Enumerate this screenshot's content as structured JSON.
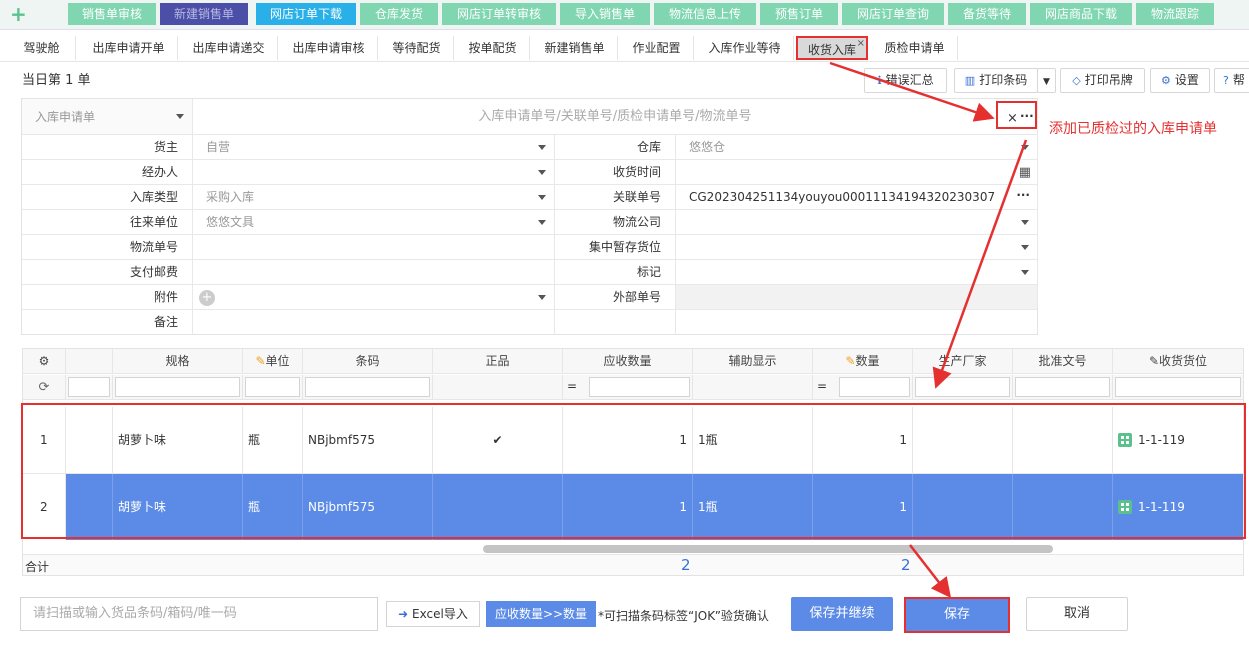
{
  "topnav": {
    "plus": "+",
    "tabs": [
      "销售单审核",
      "新建销售单",
      "网店订单下载",
      "仓库发货",
      "网店订单转审核",
      "导入销售单",
      "物流信息上传",
      "预售订单",
      "网店订单查询",
      "备货等待",
      "网店商品下载",
      "物流跟踪"
    ]
  },
  "subtabs": [
    "驾驶舱",
    "出库申请开单",
    "出库申请递交",
    "出库申请审核",
    "等待配货",
    "按单配货",
    "新建销售单",
    "作业配置",
    "入库作业等待",
    "收货入库",
    "质检申请单"
  ],
  "subtab_close": "×",
  "count_label": "当日第 1 单",
  "toolbar": {
    "errors": "错误汇总",
    "print_barcode": "打印条码",
    "print_tag": "打印吊牌",
    "settings": "设置",
    "help": "帮"
  },
  "form": {
    "doc_type": "入库申请单",
    "search_placeholder": "入库申请单号/关联单号/质检申请单号/物流单号",
    "clear": "×",
    "more": "···",
    "owner_label": "货主",
    "owner": "自营",
    "warehouse_label": "仓库",
    "warehouse": "悠悠仓",
    "handler_label": "经办人",
    "receive_time_label": "收货时间",
    "type_label": "入库类型",
    "type": "采购入库",
    "ref_label": "关联单号",
    "ref": "CG202304251134youyou00011134194320230307",
    "partner_label": "往来单位",
    "partner": "悠悠文具",
    "logistics_company_label": "物流公司",
    "tracking_label": "物流单号",
    "staging_label": "集中暂存货位",
    "postage_label": "支付邮费",
    "mark_label": "标记",
    "attach_label": "附件",
    "external_label": "外部单号",
    "remark_label": "备注"
  },
  "annotation": "添加已质检过的入库申请单",
  "grid": {
    "headers": [
      "规格",
      "单位",
      "条码",
      "正品",
      "应收数量",
      "辅助显示",
      "数量",
      "生产厂家",
      "批准文号",
      "收货货位"
    ],
    "filter_eq": "=",
    "rows": [
      {
        "idx": "1",
        "spec": "胡萝卜味",
        "unit": "瓶",
        "barcode": "NBjbmf575",
        "genuine": "✔",
        "expected": "1",
        "aux": "1瓶",
        "qty": "1",
        "maker": "",
        "approval": "",
        "location": "1-1-119"
      },
      {
        "idx": "2",
        "spec": "胡萝卜味",
        "unit": "瓶",
        "barcode": "NBjbmf575",
        "genuine": "",
        "expected": "1",
        "aux": "1瓶",
        "qty": "1",
        "maker": "",
        "approval": "",
        "location": "1-1-119"
      }
    ],
    "total_label": "合计",
    "total_expected": "2",
    "total_qty": "2"
  },
  "bottom": {
    "scan_placeholder": "请扫描或输入货品条码/箱码/唯一码",
    "excel_import": "Excel导入",
    "copy_qty": "应收数量>>数量",
    "hint": "*可扫描条码标签“JOK”验货确认",
    "save_continue": "保存并继续",
    "save": "保存",
    "cancel": "取消"
  }
}
